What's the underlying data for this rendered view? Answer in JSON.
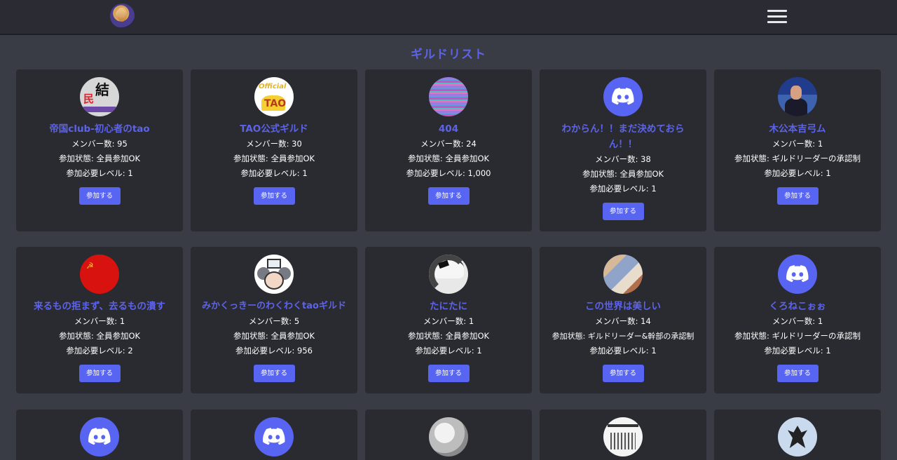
{
  "header": {
    "logo_icon": "guild-logo-icon",
    "menu_icon": "hamburger-menu-icon"
  },
  "page": {
    "title": "ギルドリスト"
  },
  "labels": {
    "members_prefix": "メンバー数: ",
    "status_prefix": "参加状態: ",
    "level_prefix": "参加必要レベル: ",
    "join_button": "参加する"
  },
  "guilds": [
    {
      "name": "帝国club-初心者のtao",
      "members": "メンバー数: 95",
      "status": "参加状態: 全員参加OK",
      "level": "参加必要レベル: 1",
      "avatar": "recruit-avatar"
    },
    {
      "name": "TAO公式ギルド",
      "members": "メンバー数: 30",
      "status": "参加状態: 全員参加OK",
      "level": "参加必要レベル: 1",
      "avatar": "tao-official-avatar"
    },
    {
      "name": "404",
      "members": "メンバー数: 24",
      "status": "参加状態: 全員参加OK",
      "level": "参加必要レベル: 1,000",
      "avatar": "glitch-avatar"
    },
    {
      "name": "わからん！！まだ決めておらん！！",
      "members": "メンバー数: 38",
      "status": "参加状態: 全員参加OK",
      "level": "参加必要レベル: 1",
      "avatar": "discord-avatar"
    },
    {
      "name": "木公本吉弓ム",
      "members": "メンバー数: 1",
      "status": "参加状態: ギルドリーダーの承認制",
      "level": "参加必要レベル: 1",
      "avatar": "man-avatar"
    },
    {
      "name": "来るもの拒まず、去るもの潰す",
      "members": "メンバー数: 1",
      "status": "参加状態: 全員参加OK",
      "level": "参加必要レベル: 2",
      "avatar": "soviet-flag-avatar"
    },
    {
      "name": "みかくっきーのわくわくtaoギルド",
      "members": "メンバー数: 5",
      "status": "参加状態: 全員参加OK",
      "level": "参加必要レベル: 956",
      "avatar": "mouse-avatar"
    },
    {
      "name": "たにたに",
      "members": "メンバー数: 1",
      "status": "参加状態: 全員参加OK",
      "level": "参加必要レベル: 1",
      "avatar": "anime-girl-avatar"
    },
    {
      "name": "この世界は美しい",
      "members": "メンバー数: 14",
      "status": "参加状態: ギルドリーダー&幹部の承認制",
      "level": "参加必要レベル: 1",
      "avatar": "painting-avatar"
    },
    {
      "name": "くろねこぉぉ",
      "members": "メンバー数: 1",
      "status": "参加状態: ギルドリーダーの承認制",
      "level": "参加必要レベル: 1",
      "avatar": "discord-avatar"
    }
  ],
  "row3_avatars": [
    "discord-avatar",
    "discord-avatar",
    "sketch-avatar",
    "manga-avatar",
    "dragon-avatar"
  ],
  "colors": {
    "background": "#393b45",
    "card": "#2a2b31",
    "accent": "#5d63e6",
    "button": "#5865f2"
  }
}
